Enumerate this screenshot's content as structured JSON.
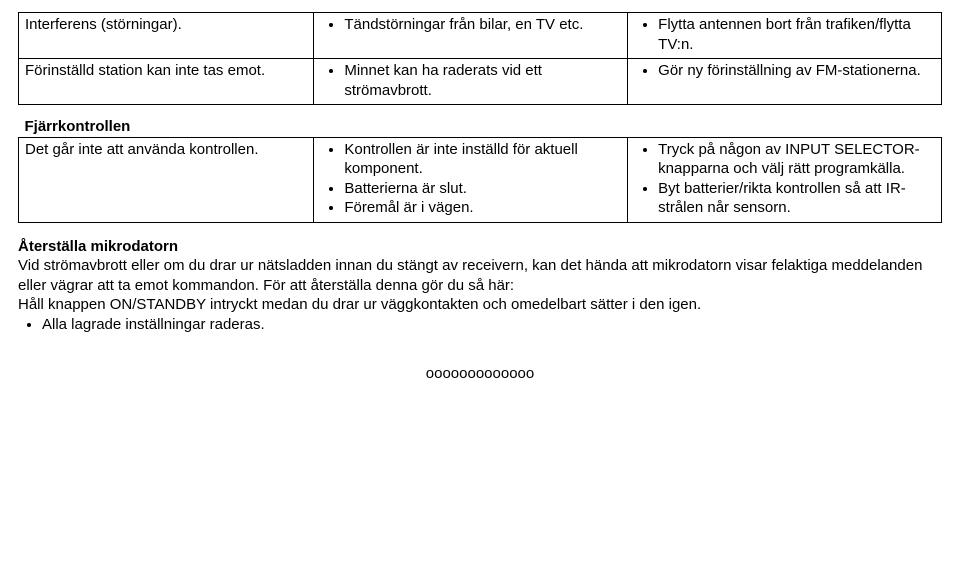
{
  "table1": {
    "rows": [
      {
        "c1": "Interferens (störningar).",
        "c2": [
          "Tändstörningar från bilar, en TV etc."
        ],
        "c3": [
          "Flytta antennen bort från trafiken/flytta TV:n."
        ]
      },
      {
        "c1": "Förinställd station kan inte tas emot.",
        "c2": [
          "Minnet kan ha raderats vid ett strömavbrott."
        ],
        "c3": [
          "Gör ny förinställning av FM-stationerna."
        ]
      }
    ],
    "section_title": "Fjärrkontrollen",
    "row3": {
      "c1": "Det går inte att använda kontrollen.",
      "c2": [
        "Kontrollen är inte inställd för aktuell komponent.",
        "Batterierna är slut.",
        "Föremål är i vägen."
      ],
      "c3": [
        "Tryck på någon av INPUT SELECTOR-knapparna och välj rätt programkälla.",
        "Byt batterier/rikta kontrollen så att IR-strålen når sensorn."
      ]
    }
  },
  "paragraphs": {
    "title": "Återställa mikrodatorn",
    "p1": "Vid strömavbrott eller om du drar ur nätsladden innan du stängt av receivern, kan det hända att mikrodatorn visar felaktiga meddelanden eller vägrar att ta emot kommandon. För att återställa denna gör du så här:",
    "p2": "Håll knappen ON/STANDBY intryckt medan du drar ur väggkontakten och omedelbart sätter i den igen.",
    "bullet": "Alla lagrade inställningar raderas."
  },
  "separator": "ooooooooooooo"
}
